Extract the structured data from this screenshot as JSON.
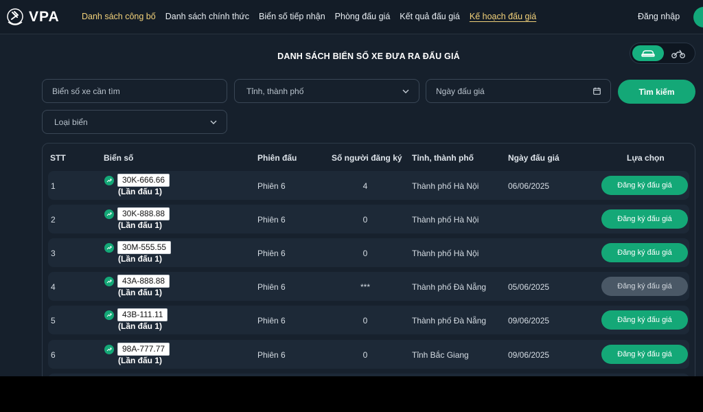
{
  "header": {
    "logo_text": "VPA",
    "nav": [
      {
        "label": "Danh sách công bố",
        "state": "active"
      },
      {
        "label": "Danh sách chính thức",
        "state": ""
      },
      {
        "label": "Biển số tiếp nhận",
        "state": ""
      },
      {
        "label": "Phòng đấu giá",
        "state": ""
      },
      {
        "label": "Kết quả đấu giá",
        "state": ""
      },
      {
        "label": "Kế hoạch đấu giá",
        "state": "underline"
      }
    ],
    "login": "Đăng nhập"
  },
  "page": {
    "title": "DANH SÁCH BIỂN SỐ XE ĐƯA RA ĐẤU GIÁ",
    "vehicle_toggle": {
      "options": [
        "car-icon",
        "motorbike-icon"
      ],
      "selected": "car-icon"
    }
  },
  "filters": {
    "plate_search": {
      "placeholder": "Biển số xe cần tìm",
      "value": ""
    },
    "province": {
      "placeholder": "Tỉnh, thành phố"
    },
    "auction_date": {
      "placeholder": "Ngày đấu giá"
    },
    "plate_type": {
      "placeholder": "Loại biển"
    },
    "search_button": "Tìm kiếm"
  },
  "table": {
    "headers": {
      "stt": "STT",
      "plate": "Biển số",
      "session": "Phiên đấu",
      "registrants": "Số người đăng ký",
      "province": "Tỉnh, thành phố",
      "date": "Ngày đấu giá",
      "action": "Lựa chọn"
    },
    "rows": [
      {
        "stt": "1",
        "plate": "30K-666.66",
        "round": "(Lần đấu 1)",
        "session": "Phiên 6",
        "registrants": "4",
        "province": "Thành phố Hà Nội",
        "date": "06/06/2025",
        "action": "Đăng ký đấu giá",
        "enabled": true
      },
      {
        "stt": "2",
        "plate": "30K-888.88",
        "round": "(Lần đấu 1)",
        "session": "Phiên 6",
        "registrants": "0",
        "province": "Thành phố Hà Nội",
        "date": "",
        "action": "Đăng ký đấu giá",
        "enabled": true
      },
      {
        "stt": "3",
        "plate": "30M-555.55",
        "round": "(Lần đấu 1)",
        "session": "Phiên 6",
        "registrants": "0",
        "province": "Thành phố Hà Nội",
        "date": "",
        "action": "Đăng ký đấu giá",
        "enabled": true
      },
      {
        "stt": "4",
        "plate": "43A-888.88",
        "round": "(Lần đấu 1)",
        "session": "Phiên 6",
        "registrants": "***",
        "province": "Thành phố Đà Nẵng",
        "date": "05/06/2025",
        "action": "Đăng ký đấu giá",
        "enabled": false
      },
      {
        "stt": "5",
        "plate": "43B-111.11",
        "round": "(Lần đấu 1)",
        "session": "Phiên 6",
        "registrants": "0",
        "province": "Thành phố Đà Nẵng",
        "date": "09/06/2025",
        "action": "Đăng ký đấu giá",
        "enabled": true
      },
      {
        "stt": "6",
        "plate": "98A-777.77",
        "round": "(Lần đấu 1)",
        "session": "Phiên 6",
        "registrants": "0",
        "province": "Tỉnh Bắc Giang",
        "date": "09/06/2025",
        "action": "Đăng ký đấu giá",
        "enabled": true
      }
    ]
  },
  "colors": {
    "background": "#16202c",
    "accent": "#14a877",
    "highlight_nav": "#f3d27a",
    "disabled_button": "#4a5866"
  }
}
